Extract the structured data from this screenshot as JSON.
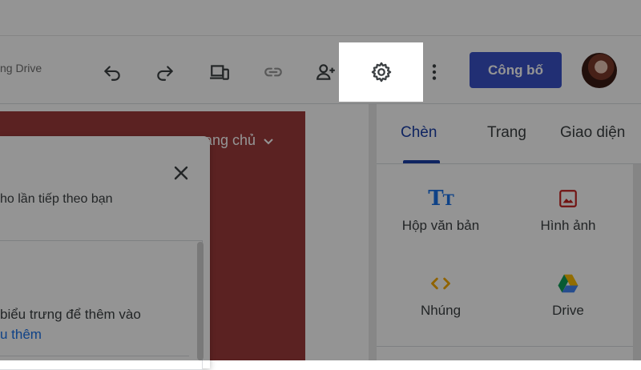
{
  "header": {
    "saved_status": "ng Drive",
    "publish_label": "Công bố"
  },
  "toolbar_icons": [
    "undo-icon",
    "redo-icon",
    "preview-device-icon",
    "link-icon",
    "share-add-person-icon",
    "settings-gear-icon",
    "more-vert-icon"
  ],
  "canvas": {
    "nav_item": "ang chủ"
  },
  "dialog": {
    "text_top": "ho lần tiếp theo bạn",
    "text_body": "biểu trưng để thêm vào",
    "link_text": "u thêm"
  },
  "panel": {
    "tabs": [
      {
        "label": "Chèn",
        "active": true
      },
      {
        "label": "Trang",
        "active": false
      },
      {
        "label": "Giao diện",
        "active": false
      }
    ],
    "insert_items": [
      {
        "label": "Hộp văn bản",
        "icon": "text-box-icon"
      },
      {
        "label": "Hình ảnh",
        "icon": "image-icon"
      },
      {
        "label": "Nhúng",
        "icon": "embed-code-icon"
      },
      {
        "label": "Drive",
        "icon": "google-drive-icon"
      }
    ]
  },
  "colors": {
    "accent": "#1a3fa8",
    "publish_bg": "#3a52c8",
    "canvas_bg": "#9e3b3b",
    "image_icon": "#c5221f",
    "embed_icon": "#f9ab00"
  }
}
